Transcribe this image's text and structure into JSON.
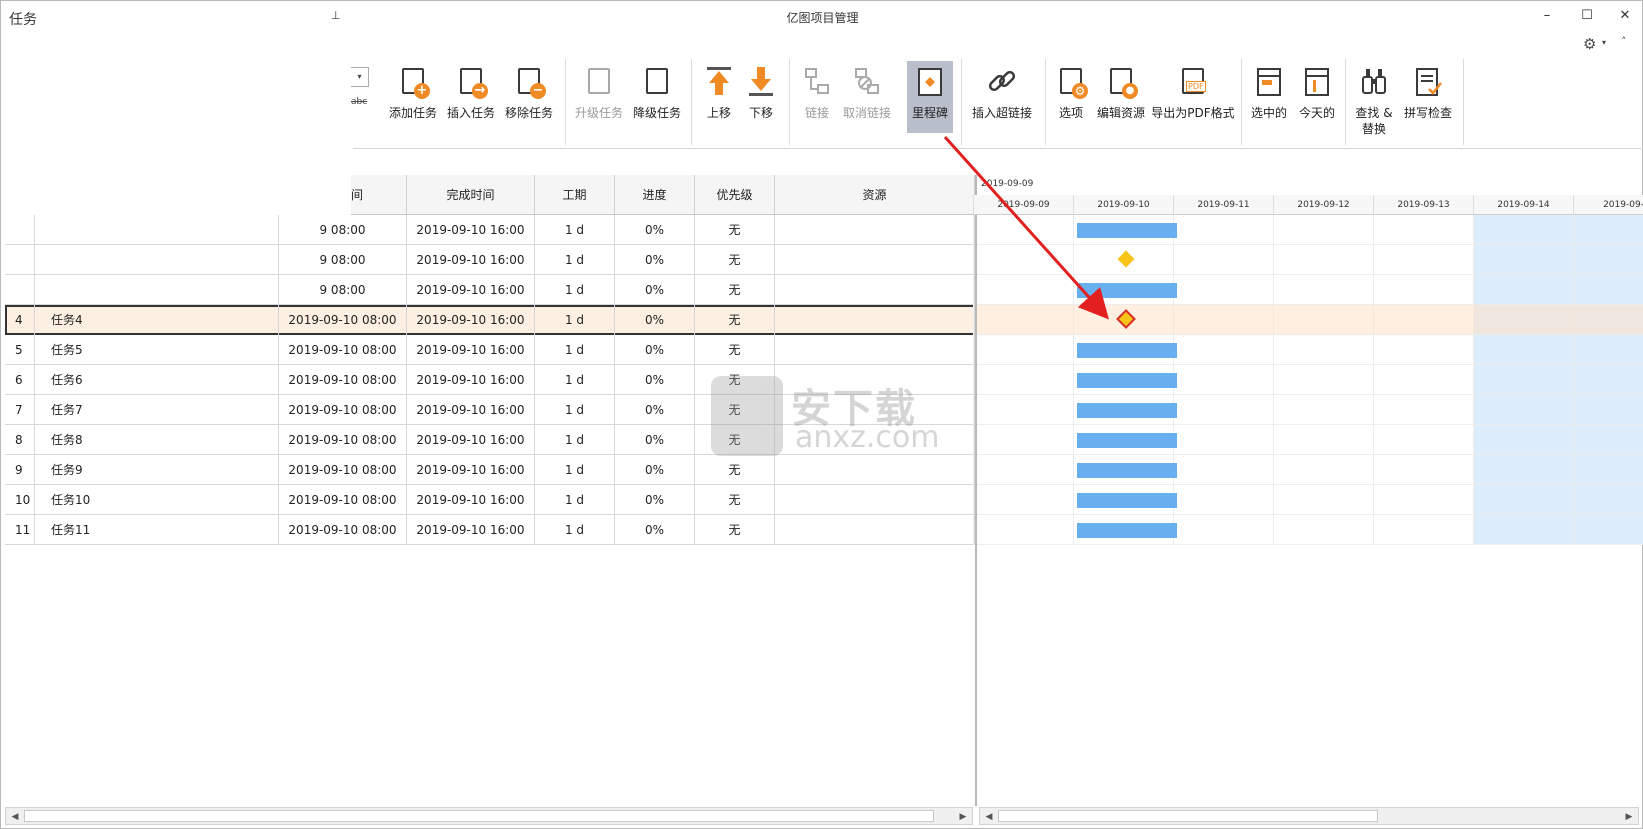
{
  "window": {
    "title": "亿图项目管理",
    "minimize": "–",
    "maximize": "☐",
    "close": "✕"
  },
  "settings": {
    "gear": "⚙",
    "caret": "▾",
    "collapse": "˄"
  },
  "task_pane": {
    "title": "任务",
    "pin": "⊥",
    "combo_caret": "▾",
    "abc": "abc"
  },
  "ribbon": {
    "add_task": "添加任务",
    "insert_task": "插入任务",
    "remove_task": "移除任务",
    "upgrade_task": "升级任务",
    "downgrade_task": "降级任务",
    "move_up": "上移",
    "move_down": "下移",
    "link": "链接",
    "unlink": "取消链接",
    "milestone": "里程碑",
    "insert_hyperlink": "插入超链接",
    "options": "选项",
    "edit_resource": "编辑资源",
    "export_pdf": "导出为PDF格式",
    "selected": "选中的",
    "today": "今天的",
    "find_replace_1": "查找 &",
    "find_replace_2": "替换",
    "spell_check": "拼写检查",
    "pdf_badge": "PDF",
    "plus": "+",
    "arrow": "→",
    "minus": "−"
  },
  "table": {
    "headers": {
      "start_partial": "间",
      "finish": "完成时间",
      "duration": "工期",
      "progress": "进度",
      "priority": "优先级",
      "resource": "资源"
    },
    "rows": [
      {
        "num": "",
        "name": "",
        "start": "9 08:00",
        "finish": "2019-09-10 16:00",
        "duration": "1 d",
        "progress": "0%",
        "priority": "无",
        "resource": ""
      },
      {
        "num": "",
        "name": "",
        "start": "9 08:00",
        "finish": "2019-09-10 16:00",
        "duration": "1 d",
        "progress": "0%",
        "priority": "无",
        "resource": ""
      },
      {
        "num": "",
        "name": "",
        "start": "9 08:00",
        "finish": "2019-09-10 16:00",
        "duration": "1 d",
        "progress": "0%",
        "priority": "无",
        "resource": ""
      },
      {
        "num": "4",
        "name": "任务4",
        "start": "2019-09-10 08:00",
        "finish": "2019-09-10 16:00",
        "duration": "1 d",
        "progress": "0%",
        "priority": "无",
        "resource": ""
      },
      {
        "num": "5",
        "name": "任务5",
        "start": "2019-09-10 08:00",
        "finish": "2019-09-10 16:00",
        "duration": "1 d",
        "progress": "0%",
        "priority": "无",
        "resource": ""
      },
      {
        "num": "6",
        "name": "任务6",
        "start": "2019-09-10 08:00",
        "finish": "2019-09-10 16:00",
        "duration": "1 d",
        "progress": "0%",
        "priority": "无",
        "resource": ""
      },
      {
        "num": "7",
        "name": "任务7",
        "start": "2019-09-10 08:00",
        "finish": "2019-09-10 16:00",
        "duration": "1 d",
        "progress": "0%",
        "priority": "无",
        "resource": ""
      },
      {
        "num": "8",
        "name": "任务8",
        "start": "2019-09-10 08:00",
        "finish": "2019-09-10 16:00",
        "duration": "1 d",
        "progress": "0%",
        "priority": "无",
        "resource": ""
      },
      {
        "num": "9",
        "name": "任务9",
        "start": "2019-09-10 08:00",
        "finish": "2019-09-10 16:00",
        "duration": "1 d",
        "progress": "0%",
        "priority": "无",
        "resource": ""
      },
      {
        "num": "10",
        "name": "任务10",
        "start": "2019-09-10 08:00",
        "finish": "2019-09-10 16:00",
        "duration": "1 d",
        "progress": "0%",
        "priority": "无",
        "resource": ""
      },
      {
        "num": "11",
        "name": "任务11",
        "start": "2019-09-10 08:00",
        "finish": "2019-09-10 16:00",
        "duration": "1 d",
        "progress": "0%",
        "priority": "无",
        "resource": ""
      }
    ]
  },
  "gantt": {
    "top_date": "2019-09-09",
    "days": [
      "2019-09-09",
      "2019-09-10",
      "2019-09-11",
      "2019-09-12",
      "2019-09-13",
      "2019-09-14",
      "2019-09-"
    ],
    "row_kinds": [
      "bar",
      "milestone",
      "bar",
      "milestone",
      "bar",
      "bar",
      "bar",
      "bar",
      "bar",
      "bar",
      "bar"
    ],
    "selected_row": 3,
    "bar_color": "#68aff0",
    "milestone_color": "#f7c518"
  },
  "watermark": {
    "cn": "安下载",
    "en": "anxz.com"
  },
  "scroll": {
    "left": "◀",
    "right": "▶"
  }
}
